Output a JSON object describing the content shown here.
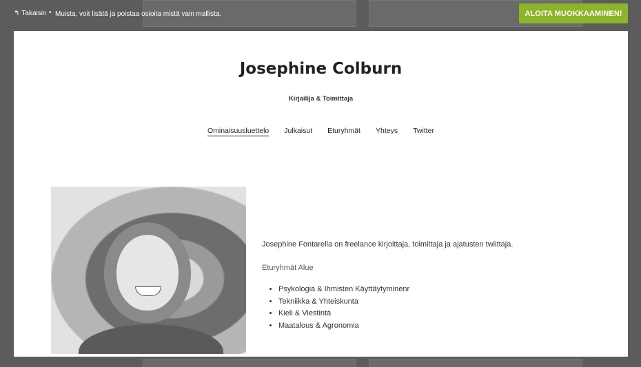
{
  "topbar": {
    "back_label": "Takaisin",
    "separator": "•",
    "note": "Muista, voit lisätä ja poistaa osioita mistä vain mallista.",
    "start_button": "ALOITA MUOKKAAMINEN!"
  },
  "site": {
    "title": "Josephine Colburn",
    "subtitle": "Kirjailija & Toimittaja",
    "nav": [
      {
        "label": "Ominaisuusluettelo",
        "active": true
      },
      {
        "label": "Julkaisut",
        "active": false
      },
      {
        "label": "Eturyhmät",
        "active": false
      },
      {
        "label": "Yhteys",
        "active": false
      },
      {
        "label": "Twitter",
        "active": false
      }
    ],
    "bio": "Josephine Fontarella on freelance kirjoittaja, toimittaja ja ajatusten twiittaja.",
    "expertise_heading": "Eturyhmät Alue",
    "expertise": [
      "Psykologia & Ihmisten Käyttäytyminenr",
      "Tekniikka & Yhteiskunta",
      "Kieli & Viestintä",
      "Maatalous & Agronomia"
    ]
  },
  "colors": {
    "accent": "#8cb52a",
    "overlay": "#5c5c5c"
  },
  "icons": {
    "back": "back-arrow-icon"
  }
}
